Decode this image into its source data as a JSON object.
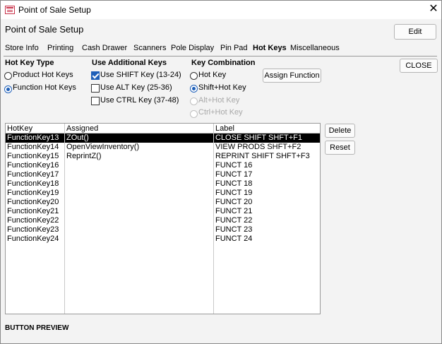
{
  "window": {
    "title": "Point of Sale Setup"
  },
  "form": {
    "title": "Point of Sale Setup",
    "edit_label": "Edit"
  },
  "tabs": [
    {
      "label": "Store Info"
    },
    {
      "label": "Printing"
    },
    {
      "label": "Cash Drawer"
    },
    {
      "label": "Scanners"
    },
    {
      "label": "Pole Display"
    },
    {
      "label": "Pin Pad"
    },
    {
      "label": "Hot Keys",
      "active": true
    },
    {
      "label": "Miscellaneous"
    }
  ],
  "hotkey_type": {
    "title": "Hot Key Type",
    "options": [
      {
        "label": "Product Hot Keys",
        "selected": false
      },
      {
        "label": "Function Hot Keys",
        "selected": true
      }
    ]
  },
  "additional_keys": {
    "title": "Use Additional Keys",
    "options": [
      {
        "label": "Use SHIFT Key (13-24)",
        "checked": true
      },
      {
        "label": "Use ALT Key (25-36)",
        "checked": false
      },
      {
        "label": "Use CTRL Key (37-48)",
        "checked": false
      }
    ]
  },
  "key_combination": {
    "title": "Key Combination",
    "options": [
      {
        "label": "Hot Key",
        "selected": false,
        "enabled": true
      },
      {
        "label": "Shift+Hot Key",
        "selected": true,
        "enabled": true
      },
      {
        "label": "Alt+Hot Key",
        "selected": false,
        "enabled": false
      },
      {
        "label": "Ctrl+Hot Key",
        "selected": false,
        "enabled": false
      }
    ]
  },
  "assign_function_label": "Assign Function",
  "close_shift_label": "CLOSE SHIFT",
  "grid": {
    "headers": [
      "HotKey",
      "Assigned",
      "Label"
    ],
    "rows": [
      {
        "hotkey": "FunctionKey13",
        "assigned": "ZOut()",
        "label": "CLOSE SHIFT SHFT+F1",
        "selected": true
      },
      {
        "hotkey": "FunctionKey14",
        "assigned": "OpenViewInventory()",
        "label": "VIEW PRODS SHFT+F2"
      },
      {
        "hotkey": "FunctionKey15",
        "assigned": "ReprintZ()",
        "label": "REPRINT SHIFT SHFT+F3"
      },
      {
        "hotkey": "FunctionKey16",
        "assigned": "",
        "label": "FUNCT 16"
      },
      {
        "hotkey": "FunctionKey17",
        "assigned": "",
        "label": "FUNCT 17"
      },
      {
        "hotkey": "FunctionKey18",
        "assigned": "",
        "label": "FUNCT 18"
      },
      {
        "hotkey": "FunctionKey19",
        "assigned": "",
        "label": "FUNCT 19"
      },
      {
        "hotkey": "FunctionKey20",
        "assigned": "",
        "label": "FUNCT 20"
      },
      {
        "hotkey": "FunctionKey21",
        "assigned": "",
        "label": "FUNCT 21"
      },
      {
        "hotkey": "FunctionKey22",
        "assigned": "",
        "label": "FUNCT 22"
      },
      {
        "hotkey": "FunctionKey23",
        "assigned": "",
        "label": "FUNCT 23"
      },
      {
        "hotkey": "FunctionKey24",
        "assigned": "",
        "label": "FUNCT 24"
      }
    ]
  },
  "delete_label": "Delete",
  "reset_label": "Reset",
  "button_preview_label": "BUTTON PREVIEW",
  "colors": {
    "accent": "#1e5fb8",
    "selection": "#000000"
  }
}
